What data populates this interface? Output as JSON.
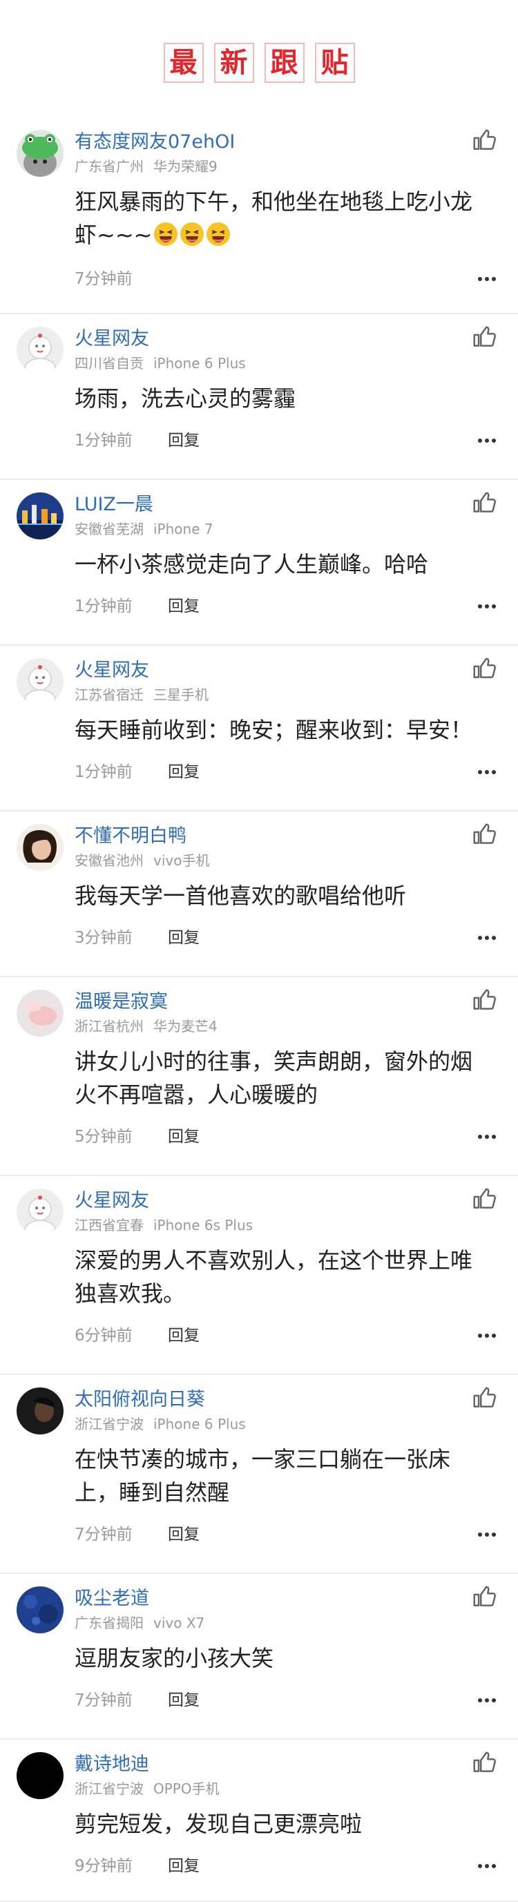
{
  "header": {
    "title_chars": [
      "最",
      "新",
      "跟",
      "贴"
    ]
  },
  "colors": {
    "title_red": "#e3262b",
    "username_blue": "#2f6eb5",
    "meta_gray": "#9a9a9a"
  },
  "icons": {
    "like": "thumbs-up-icon",
    "more": "more-dots-icon"
  },
  "comments": [
    {
      "username": "有态度网友07ehOI",
      "location": "广东省广州",
      "device": "华为荣耀9",
      "content": "狂风暴雨的下午，和他坐在地毯上吃小龙虾~~~",
      "emoji_count": 3,
      "time": "7分钟前",
      "reply_label": ""
    },
    {
      "username": "火星网友",
      "location": "四川省自贡",
      "device": "iPhone 6 Plus",
      "content": "场雨，洗去心灵的雾霾",
      "time": "1分钟前",
      "reply_label": "回复"
    },
    {
      "username": "LUIZ一晨",
      "location": "安徽省芜湖",
      "device": "iPhone 7",
      "content": "一杯小茶感觉走向了人生巅峰。哈哈",
      "time": "1分钟前",
      "reply_label": "回复"
    },
    {
      "username": "火星网友",
      "location": "江苏省宿迁",
      "device": "三星手机",
      "content": "每天睡前收到：晚安；醒来收到：早安！",
      "time": "1分钟前",
      "reply_label": "回复"
    },
    {
      "username": "不懂不明白鸭",
      "location": "安徽省池州",
      "device": "vivo手机",
      "content": "我每天学一首他喜欢的歌唱给他听",
      "time": "3分钟前",
      "reply_label": "回复"
    },
    {
      "username": "温暖是寂寞",
      "location": "浙江省杭州",
      "device": "华为麦芒4",
      "content": "讲女儿小时的往事，笑声朗朗，窗外的烟火不再喧嚣，人心暖暖的",
      "time": "5分钟前",
      "reply_label": "回复"
    },
    {
      "username": "火星网友",
      "location": "江西省宜春",
      "device": "iPhone 6s Plus",
      "content": "深爱的男人不喜欢别人，在这个世界上唯独喜欢我。",
      "time": "6分钟前",
      "reply_label": "回复"
    },
    {
      "username": "太阳俯视向日葵",
      "location": "浙江省宁波",
      "device": "iPhone 6 Plus",
      "content": "在快节凑的城市，一家三口躺在一张床上，睡到自然醒",
      "time": "7分钟前",
      "reply_label": "回复"
    },
    {
      "username": "吸尘老道",
      "location": "广东省揭阳",
      "device": "vivo X7",
      "content": "逗朋友家的小孩大笑",
      "time": "7分钟前",
      "reply_label": "回复"
    },
    {
      "username": "戴诗地迪",
      "location": "浙江省宁波",
      "device": "OPPO手机",
      "content": "剪完短发，发现自己更漂亮啦",
      "time": "9分钟前",
      "reply_label": "回复"
    }
  ]
}
